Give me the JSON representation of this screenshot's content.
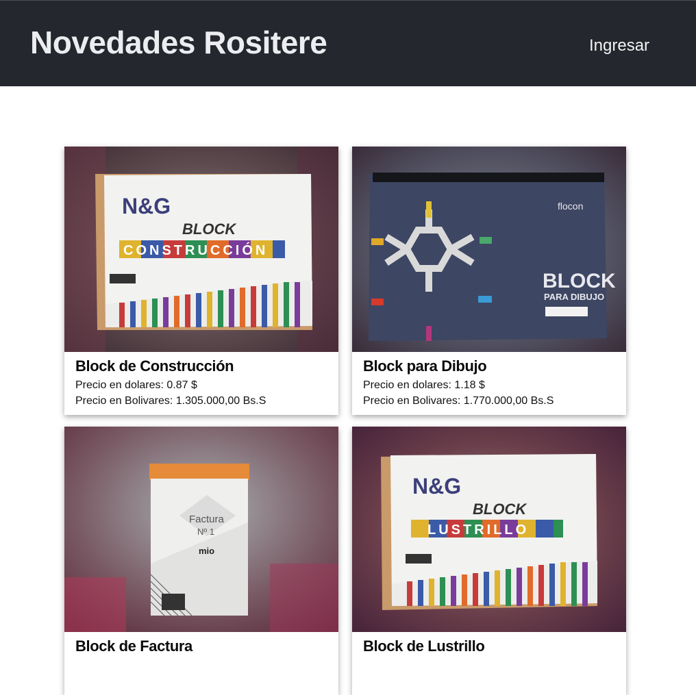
{
  "header": {
    "title": "Novedades Rositere",
    "login_label": "Ingresar"
  },
  "colors": {
    "header_bg": "#24272d",
    "header_text": "#ecedf0",
    "page_bg": "#ffffff"
  },
  "products": [
    {
      "name": "Block de Construcción",
      "price_usd": "Precio en dolares: 0.87 $",
      "price_bs": "Precio en Bolivares: 1.305.000,00 Bs.S",
      "image": {
        "brand": "N&G",
        "line1": "BLOCK",
        "line2": "CONSTRUCCIÓN"
      }
    },
    {
      "name": "Block para Dibujo",
      "price_usd": "Precio en dolares: 1.18 $",
      "price_bs": "Precio en Bolivares: 1.770.000,00 Bs.S",
      "image": {
        "brand": "flocon",
        "line1": "BLOCK",
        "line2": "PARA DIBUJO"
      }
    },
    {
      "name": "Block de Factura",
      "price_usd": "",
      "price_bs": "",
      "image": {
        "line1": "Factura",
        "line2": "Nº 1",
        "brand": "mio"
      }
    },
    {
      "name": "Block de Lustrillo",
      "price_usd": "",
      "price_bs": "",
      "image": {
        "brand": "N&G",
        "line1": "BLOCK",
        "line2": "LUSTRILLO"
      }
    }
  ]
}
